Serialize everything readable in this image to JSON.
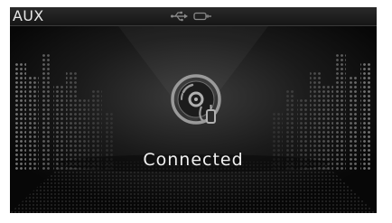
{
  "header": {
    "title": "AUX",
    "icons": [
      "usb-icon",
      "aux-plug-icon"
    ]
  },
  "main": {
    "device_icon": "disc-with-cable-icon",
    "status": "Connected"
  },
  "colors": {
    "background": "#0c0c0c",
    "text": "#f2f2f2",
    "icon": "#9a9a9a"
  }
}
